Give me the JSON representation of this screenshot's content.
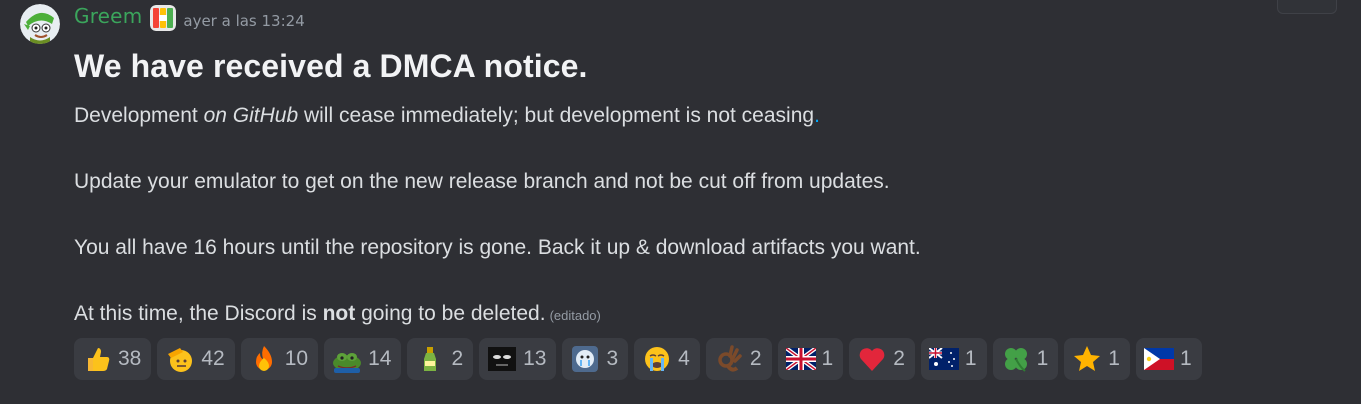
{
  "message": {
    "author": "Greem",
    "timestamp": "ayer a las 13:24",
    "heading": "We have received a DMCA notice.",
    "line1": {
      "before": "Development ",
      "emphasis": "on GitHub",
      "after": " will cease immediately; but development is not ceasing",
      "end_dot": "."
    },
    "line2": "Update your emulator to get on the new release branch and not be cut off from updates.",
    "line3": "You all have 16 hours until the repository is gone. Back it up & download artifacts you want.",
    "line4": {
      "before": "At this time, the Discord is ",
      "bold": "not",
      "after": " going to be deleted.",
      "edited": "(editado)"
    }
  },
  "reactions": [
    {
      "icon": "thumbs-up-icon",
      "count": "38"
    },
    {
      "icon": "saluting-face-icon",
      "count": "42"
    },
    {
      "icon": "fire-icon",
      "count": "10"
    },
    {
      "icon": "pepe-frog-icon",
      "count": "14"
    },
    {
      "icon": "bottle-icon",
      "count": "2"
    },
    {
      "icon": "dark-face-icon",
      "count": "13"
    },
    {
      "icon": "crying-character-icon",
      "count": "3"
    },
    {
      "icon": "loudly-crying-face-icon",
      "count": "4"
    },
    {
      "icon": "ok-hand-icon",
      "count": "2"
    },
    {
      "icon": "uk-flag-icon",
      "count": "1"
    },
    {
      "icon": "red-heart-icon",
      "count": "2"
    },
    {
      "icon": "australia-flag-icon",
      "count": "1"
    },
    {
      "icon": "four-leaf-clover-icon",
      "count": "1"
    },
    {
      "icon": "star-icon",
      "count": "1"
    },
    {
      "icon": "philippines-flag-icon",
      "count": "1"
    }
  ],
  "colors": {
    "background": "#2e2f34",
    "username": "#3ba55c",
    "text": "#dbdee1",
    "muted": "#949ba4",
    "reaction_bg": "#3a3c42",
    "link_dot": "#00a8fc"
  }
}
